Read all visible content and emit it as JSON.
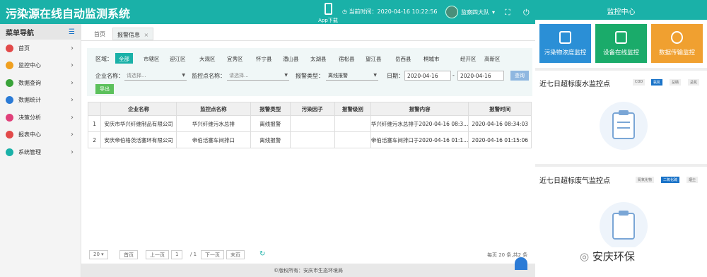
{
  "header": {
    "title": "污染源在线自动监测系统",
    "app_download": "App下载",
    "clock_label": "当前时间：2020-04-16 10:22:56",
    "user": "监察四大队"
  },
  "sidebar": {
    "title": "菜单导航",
    "items": [
      {
        "label": "首页",
        "color": "#e24a4a"
      },
      {
        "label": "监控中心",
        "color": "#f0a020"
      },
      {
        "label": "数据查询",
        "color": "#3aa33a"
      },
      {
        "label": "数据统计",
        "color": "#2b7bd6"
      },
      {
        "label": "决策分析",
        "color": "#e0407a"
      },
      {
        "label": "报表中心",
        "color": "#e24a4a"
      },
      {
        "label": "系统管理",
        "color": "#1ab1a8"
      }
    ]
  },
  "tabs": {
    "home": "首页",
    "alarm": "报警信息",
    "close": "×"
  },
  "filter": {
    "region_label": "区域：",
    "regions": [
      "全部",
      "市辖区",
      "迎江区",
      "大观区",
      "宜秀区",
      "怀宁县",
      "潜山县",
      "太湖县",
      "宿松县",
      "望江县",
      "岳西县",
      "桐城市",
      "经开区",
      "高新区"
    ],
    "company_label": "企业名称：",
    "company_ph": "请选择...",
    "site_label": "监控点名称：",
    "site_ph": "请选择...",
    "type_label": "报警类型：",
    "type_value": "离线报警",
    "date_label": "日期：",
    "date_from": "2020-04-16",
    "date_to": "2020-04-16",
    "date_sep": "-",
    "query_btn": "查询",
    "export_btn": "导出"
  },
  "table": {
    "headers": [
      "企业名称",
      "监控点名称",
      "报警类型",
      "污染因子",
      "报警级别",
      "报警内容",
      "报警时间"
    ],
    "rows": [
      {
        "no": "1",
        "company": "安庆市华兴纤维制品有限公司",
        "site": "华兴纤维污水总排",
        "type": "离线报警",
        "factor": "",
        "level": "",
        "content": "华兴纤维污水总排于2020-04-16 08:3...",
        "time": "2020-04-16 08:34:03"
      },
      {
        "no": "2",
        "company": "安庆帝伯格茨活塞环有限公司",
        "site": "帝伯活塞车间排口",
        "type": "离线报警",
        "factor": "",
        "level": "",
        "content": "帝伯活塞车间排口于2020-04-16 01:1...",
        "time": "2020-04-16 01:15:06"
      }
    ]
  },
  "pager": {
    "page_size": "20",
    "first": "首页",
    "prev": "上一页",
    "page": "1",
    "total": "/ 1",
    "next": "下一页",
    "last": "末页",
    "summary": "每页 20 条,共2 条"
  },
  "footer": "©版权所有：安庆市生态环境局",
  "right": {
    "title": "监控中心",
    "tiles": [
      {
        "label": "污染物浓度监控",
        "color": "#2b8fd6"
      },
      {
        "label": "设备在线监控",
        "color": "#1aab6a"
      },
      {
        "label": "数据传输监控",
        "color": "#f0a030"
      }
    ],
    "water": {
      "title": "近七日超标废水监控点",
      "chips": [
        "COD",
        "氨氮",
        "总磷",
        "总氮"
      ]
    },
    "gas": {
      "title": "近七日超标废气监控点",
      "chips": [
        "氮氧化物",
        "二氧化硫",
        "烟尘"
      ]
    },
    "watermark": "安庆环保"
  }
}
